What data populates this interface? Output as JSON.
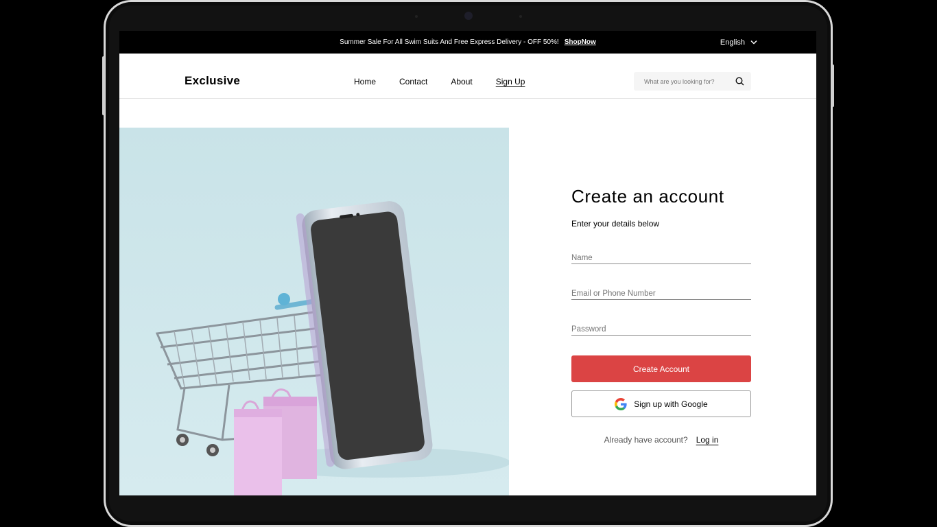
{
  "topbar": {
    "promo_text": "Summer Sale For All Swim Suits And Free Express Delivery - OFF 50%!",
    "promo_link": "ShopNow",
    "language": "English"
  },
  "header": {
    "logo": "Exclusive",
    "nav": [
      "Home",
      "Contact",
      "About",
      "Sign Up"
    ],
    "active_nav": "Sign Up",
    "search_placeholder": "What are you looking for?"
  },
  "form": {
    "title": "Create an account",
    "subtitle": "Enter your details below",
    "name_placeholder": "Name",
    "email_placeholder": "Email or Phone Number",
    "password_placeholder": "Password",
    "create_button": "Create Account",
    "google_button": "Sign up with Google",
    "login_prompt": "Already have account?",
    "login_link": "Log in"
  },
  "colors": {
    "accent": "#DB4444",
    "hero_bg": "#CBE4E8"
  },
  "icons": [
    "search-icon",
    "chevron-down-icon",
    "google-icon"
  ]
}
